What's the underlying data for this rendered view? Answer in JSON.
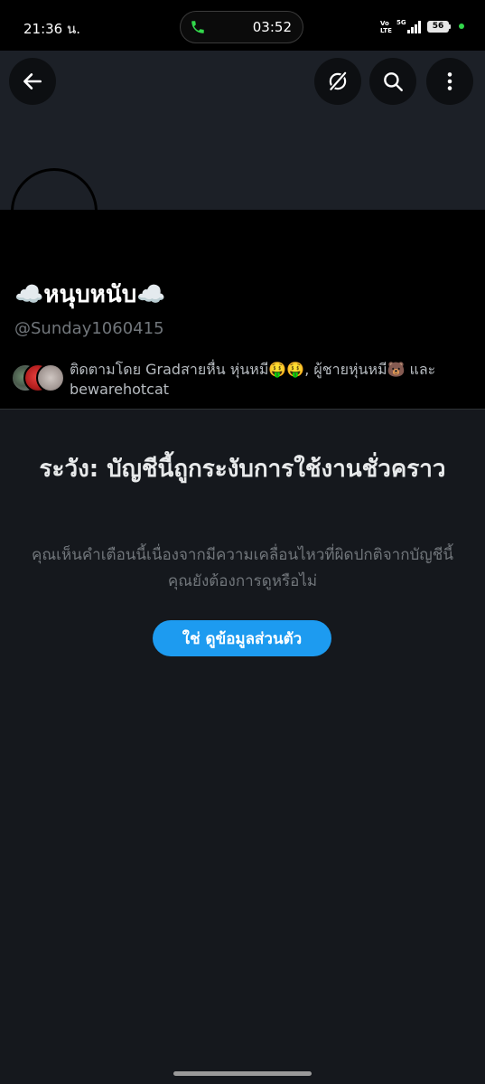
{
  "status_bar": {
    "time": "21:36 น.",
    "call_timer": "03:52",
    "volte": "Vo\nLTE",
    "network": "5G",
    "battery": "56"
  },
  "toolbar": {
    "icons": [
      "back-arrow-icon",
      "grok-icon",
      "search-icon",
      "more-vertical-icon"
    ]
  },
  "profile": {
    "display_name": "☁️หนุบหนับ☁️",
    "handle": "@Sunday1060415",
    "followed_by": "ติดตามโดย Gradสายหื่น หุ่นหมี🤑🤑, ผู้ชายหุ่นหมี🐻 และ bewarehotcat"
  },
  "warning": {
    "title": "ระวัง: บัญชีนี้ถูกระงับการใช้งานชั่วคราว",
    "body": "คุณเห็นคำเตือนนี้เนื่องจากมีความเคลื่อนไหวที่ผิดปกติจากบัญชีนี้ คุณยังต้องการดูหรือไม่",
    "button_label": "ใช่ ดูข้อมูลส่วนตัว"
  },
  "colors": {
    "accent": "#1d9bf0",
    "background": "#15181d",
    "banner": "#1c2027",
    "muted_text": "#71767b",
    "call_green": "#32d74b"
  }
}
